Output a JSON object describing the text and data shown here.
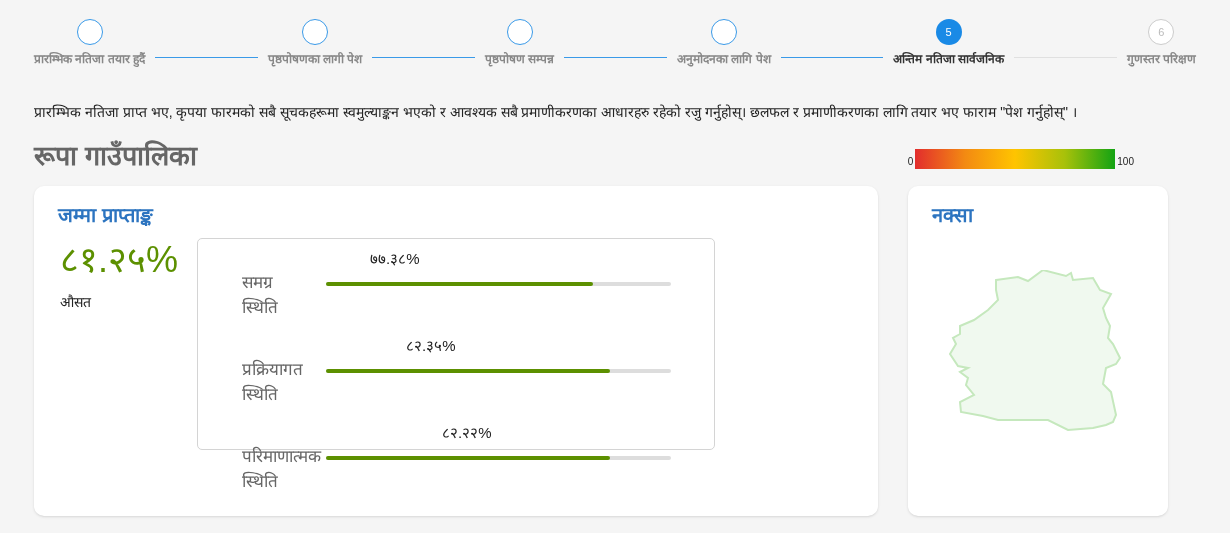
{
  "stepper": [
    {
      "label": "प्रारम्भिक नतिजा तयार हुदैं",
      "kind": "done"
    },
    {
      "label": "पृष्ठपोषणका लागी पेश",
      "kind": "done"
    },
    {
      "label": "पृष्ठपोषण सम्पन्न",
      "kind": "done"
    },
    {
      "label": "अनुमोदनका लागि पेश",
      "kind": "done"
    },
    {
      "label": "अन्तिम नतिजा सार्वजनिक",
      "kind": "current",
      "number": "5"
    },
    {
      "label": "गुणस्तर परिक्षण",
      "kind": "pending",
      "number": "6"
    }
  ],
  "instructions": "प्रारम्भिक नतिजा प्राप्त भए, कृपया फारमको सबै सूचकहरूमा स्वमुल्याङ्कन भएको र आवश्यक सबै प्रमाणीकरणका आधारहरु रहेको रजु गर्नुहोस्। छलफल र प्रमाणीकरणका लागि तयार भए फाराम \"पेश गर्नुहोस्\" ।",
  "title": "रूपा गाउँपालिका",
  "legend": {
    "min": "0",
    "max": "100"
  },
  "score_card": {
    "heading": "जम्मा प्राप्ताङ्क",
    "total": "८१.२५%",
    "total_label": "औसत",
    "bars": [
      {
        "label": "समग्र स्थिति",
        "value": "७७.३८%",
        "level": 0.7738
      },
      {
        "label": "प्रक्रियागत स्थिति",
        "value": "८२.३५%",
        "level": 0.8235
      },
      {
        "label": "परिमाणात्मक स्थिति",
        "value": "८२.२२%",
        "level": 0.8222
      }
    ]
  },
  "map_card": {
    "heading": "नक्सा"
  }
}
